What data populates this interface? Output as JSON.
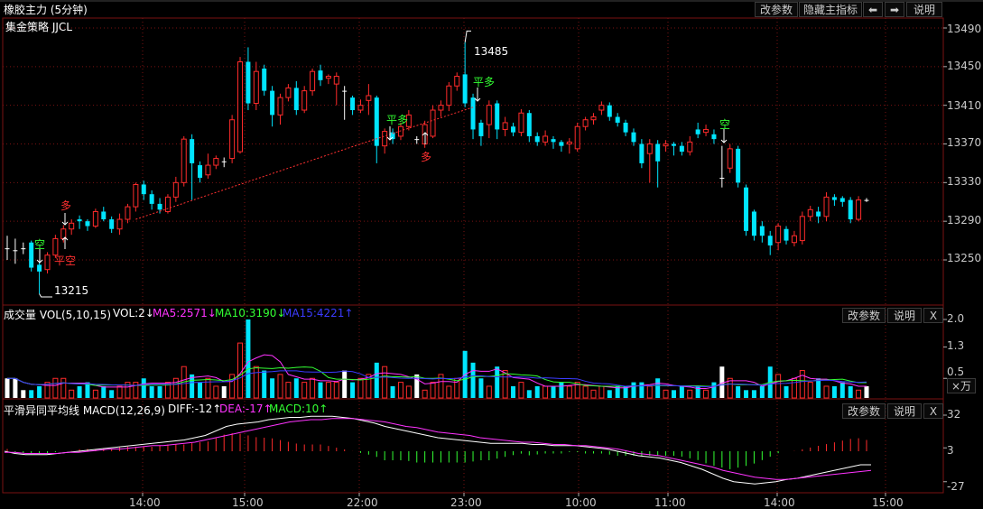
{
  "title": "橡胶主力 (5分钟)",
  "strategy_label": "集金策略 JJCL",
  "buttons": {
    "params": "改参数",
    "hide_main": "隐藏主指标",
    "help": "说明",
    "close": "X",
    "unit": "×万"
  },
  "icons": [
    "arrow-left-icon",
    "arrow-right-icon"
  ],
  "colors": {
    "up": "#ff2b2b",
    "down": "#00e5ff",
    "flat": "#ffffff",
    "grid": "#7a1212",
    "ma5": "#ff33ff",
    "ma10": "#33ff33",
    "ma15": "#3b3bff",
    "dif": "#ffffff",
    "dea": "#ff33ff"
  },
  "price_axis": {
    "ticks": [
      "13490",
      "13450",
      "13410",
      "13370",
      "13330",
      "13290",
      "13250"
    ]
  },
  "vol_axis": {
    "ticks": [
      "2.0",
      "1.3",
      "0.5"
    ]
  },
  "macd_axis": {
    "ticks": [
      "32",
      "3",
      "-27"
    ]
  },
  "time_axis": {
    "labels": [
      "14:00",
      "15:00",
      "22:00",
      "23:00",
      "10:00",
      "11:00",
      "14:00",
      "15:00"
    ]
  },
  "volume_panel": {
    "name": "成交量 VOL(5,10,15)",
    "vol": "VOL:2↓",
    "ma5": "MA5:2571↓",
    "ma10": "MA10:3190↓",
    "ma15": "MA15:4221↑"
  },
  "macd_panel": {
    "name": "平滑异同平均线 MACD(12,26,9)",
    "diff": "DIFF:-12↑",
    "dea": "DEA:-17↑",
    "macd": "MACD:10↑"
  },
  "annotations": {
    "high": "13485",
    "low": "13215",
    "long": "多",
    "short": "空",
    "close_long": "平多",
    "close_short": "平空"
  },
  "chart_data": {
    "type": "candlestick",
    "title": "橡胶主力 (5分钟)",
    "price_range": [
      13215,
      13490
    ],
    "candles": [
      {
        "open": 13262,
        "close": 13262,
        "high": 13275,
        "low": 13250
      },
      {
        "open": 13260,
        "close": 13260,
        "high": 13272,
        "low": 13246
      },
      {
        "open": 13262,
        "close": 13262,
        "high": 13268,
        "low": 13256
      },
      {
        "open": 13268,
        "close": 13242,
        "high": 13270,
        "low": 13238
      },
      {
        "open": 13245,
        "close": 13238,
        "high": 13248,
        "low": 13215
      },
      {
        "open": 13240,
        "close": 13255,
        "high": 13258,
        "low": 13236
      },
      {
        "open": 13255,
        "close": 13272,
        "high": 13276,
        "low": 13252
      },
      {
        "open": 13272,
        "close": 13282,
        "high": 13286,
        "low": 13268
      },
      {
        "open": 13282,
        "close": 13288,
        "high": 13292,
        "low": 13276
      },
      {
        "open": 13292,
        "close": 13290,
        "high": 13296,
        "low": 13282
      },
      {
        "open": 13290,
        "close": 13285,
        "high": 13292,
        "low": 13280
      },
      {
        "open": 13285,
        "close": 13300,
        "high": 13303,
        "low": 13283
      },
      {
        "open": 13300,
        "close": 13292,
        "high": 13305,
        "low": 13290
      },
      {
        "open": 13292,
        "close": 13282,
        "high": 13295,
        "low": 13278
      },
      {
        "open": 13282,
        "close": 13292,
        "high": 13298,
        "low": 13276
      },
      {
        "open": 13292,
        "close": 13305,
        "high": 13308,
        "low": 13288
      },
      {
        "open": 13305,
        "close": 13328,
        "high": 13330,
        "low": 13300
      },
      {
        "open": 13328,
        "close": 13318,
        "high": 13332,
        "low": 13312
      },
      {
        "open": 13318,
        "close": 13308,
        "high": 13322,
        "low": 13302
      },
      {
        "open": 13308,
        "close": 13302,
        "high": 13314,
        "low": 13298
      },
      {
        "open": 13300,
        "close": 13315,
        "high": 13318,
        "low": 13298
      },
      {
        "open": 13315,
        "close": 13330,
        "high": 13336,
        "low": 13310
      },
      {
        "open": 13330,
        "close": 13375,
        "high": 13378,
        "low": 13326
      },
      {
        "open": 13375,
        "close": 13350,
        "high": 13380,
        "low": 13312
      },
      {
        "open": 13348,
        "close": 13335,
        "high": 13352,
        "low": 13330
      },
      {
        "open": 13338,
        "close": 13348,
        "high": 13360,
        "low": 13334
      },
      {
        "open": 13348,
        "close": 13355,
        "high": 13358,
        "low": 13344
      },
      {
        "open": 13352,
        "close": 13352,
        "high": 13356,
        "low": 13346
      },
      {
        "open": 13355,
        "close": 13395,
        "high": 13400,
        "low": 13350
      },
      {
        "open": 13362,
        "close": 13455,
        "high": 13460,
        "low": 13360
      },
      {
        "open": 13455,
        "close": 13412,
        "high": 13470,
        "low": 13405
      },
      {
        "open": 13412,
        "close": 13445,
        "high": 13455,
        "low": 13405
      },
      {
        "open": 13448,
        "close": 13425,
        "high": 13452,
        "low": 13420
      },
      {
        "open": 13425,
        "close": 13400,
        "high": 13430,
        "low": 13388
      },
      {
        "open": 13400,
        "close": 13418,
        "high": 13422,
        "low": 13390
      },
      {
        "open": 13418,
        "close": 13428,
        "high": 13432,
        "low": 13414
      },
      {
        "open": 13428,
        "close": 13405,
        "high": 13435,
        "low": 13400
      },
      {
        "open": 13405,
        "close": 13425,
        "high": 13430,
        "low": 13402
      },
      {
        "open": 13425,
        "close": 13445,
        "high": 13448,
        "low": 13420
      },
      {
        "open": 13446,
        "close": 13436,
        "high": 13452,
        "low": 13430
      },
      {
        "open": 13438,
        "close": 13440,
        "high": 13442,
        "low": 13432
      },
      {
        "open": 13432,
        "close": 13440,
        "high": 13444,
        "low": 13410
      },
      {
        "open": 13425,
        "close": 13425,
        "high": 13430,
        "low": 13395
      },
      {
        "open": 13418,
        "close": 13405,
        "high": 13420,
        "low": 13400
      },
      {
        "open": 13405,
        "close": 13410,
        "high": 13416,
        "low": 13402
      },
      {
        "open": 13415,
        "close": 13420,
        "high": 13432,
        "low": 13400
      },
      {
        "open": 13418,
        "close": 13368,
        "high": 13420,
        "low": 13350
      },
      {
        "open": 13368,
        "close": 13383,
        "high": 13386,
        "low": 13360
      },
      {
        "open": 13382,
        "close": 13375,
        "high": 13386,
        "low": 13370
      },
      {
        "open": 13378,
        "close": 13388,
        "high": 13392,
        "low": 13374
      },
      {
        "open": 13388,
        "close": 13400,
        "high": 13405,
        "low": 13384
      },
      {
        "open": 13375,
        "close": 13375,
        "high": 13378,
        "low": 13370
      },
      {
        "open": 13370,
        "close": 13390,
        "high": 13394,
        "low": 13366
      },
      {
        "open": 13378,
        "close": 13405,
        "high": 13410,
        "low": 13376
      },
      {
        "open": 13405,
        "close": 13410,
        "high": 13415,
        "low": 13398
      },
      {
        "open": 13410,
        "close": 13430,
        "high": 13434,
        "low": 13404
      },
      {
        "open": 13430,
        "close": 13440,
        "high": 13444,
        "low": 13425
      },
      {
        "open": 13442,
        "close": 13412,
        "high": 13475,
        "low": 13408
      },
      {
        "open": 13418,
        "close": 13385,
        "high": 13422,
        "low": 13375
      },
      {
        "open": 13392,
        "close": 13378,
        "high": 13395,
        "low": 13368
      },
      {
        "open": 13390,
        "close": 13410,
        "high": 13415,
        "low": 13376
      },
      {
        "open": 13412,
        "close": 13385,
        "high": 13415,
        "low": 13375
      },
      {
        "open": 13385,
        "close": 13392,
        "high": 13398,
        "low": 13378
      },
      {
        "open": 13388,
        "close": 13382,
        "high": 13392,
        "low": 13378
      },
      {
        "open": 13382,
        "close": 13402,
        "high": 13406,
        "low": 13378
      },
      {
        "open": 13402,
        "close": 13378,
        "high": 13405,
        "low": 13372
      },
      {
        "open": 13378,
        "close": 13372,
        "high": 13382,
        "low": 13368
      },
      {
        "open": 13372,
        "close": 13378,
        "high": 13384,
        "low": 13368
      },
      {
        "open": 13375,
        "close": 13372,
        "high": 13378,
        "low": 13365
      },
      {
        "open": 13372,
        "close": 13368,
        "high": 13374,
        "low": 13362
      },
      {
        "open": 13370,
        "close": 13372,
        "high": 13376,
        "low": 13360
      },
      {
        "open": 13365,
        "close": 13388,
        "high": 13392,
        "low": 13362
      },
      {
        "open": 13388,
        "close": 13395,
        "high": 13398,
        "low": 13384
      },
      {
        "open": 13395,
        "close": 13398,
        "high": 13402,
        "low": 13390
      },
      {
        "open": 13405,
        "close": 13410,
        "high": 13414,
        "low": 13400
      },
      {
        "open": 13410,
        "close": 13398,
        "high": 13413,
        "low": 13394
      },
      {
        "open": 13398,
        "close": 13392,
        "high": 13402,
        "low": 13388
      },
      {
        "open": 13392,
        "close": 13382,
        "high": 13395,
        "low": 13378
      },
      {
        "open": 13382,
        "close": 13372,
        "high": 13386,
        "low": 13368
      },
      {
        "open": 13370,
        "close": 13350,
        "high": 13375,
        "low": 13345
      },
      {
        "open": 13360,
        "close": 13370,
        "high": 13375,
        "low": 13330
      },
      {
        "open": 13370,
        "close": 13352,
        "high": 13374,
        "low": 13325
      },
      {
        "open": 13368,
        "close": 13370,
        "high": 13374,
        "low": 13362
      },
      {
        "open": 13370,
        "close": 13368,
        "high": 13372,
        "low": 13358
      },
      {
        "open": 13368,
        "close": 13362,
        "high": 13372,
        "low": 13358
      },
      {
        "open": 13362,
        "close": 13372,
        "high": 13378,
        "low": 13358
      },
      {
        "open": 13385,
        "close": 13380,
        "high": 13392,
        "low": 13376
      },
      {
        "open": 13382,
        "close": 13385,
        "high": 13390,
        "low": 13378
      },
      {
        "open": 13380,
        "close": 13375,
        "high": 13385,
        "low": 13370
      },
      {
        "open": 13335,
        "close": 13335,
        "high": 13368,
        "low": 13325
      },
      {
        "open": 13345,
        "close": 13365,
        "high": 13370,
        "low": 13340
      },
      {
        "open": 13365,
        "close": 13330,
        "high": 13368,
        "low": 13325
      },
      {
        "open": 13325,
        "close": 13280,
        "high": 13328,
        "low": 13275
      },
      {
        "open": 13300,
        "close": 13275,
        "high": 13302,
        "low": 13270
      },
      {
        "open": 13285,
        "close": 13275,
        "high": 13290,
        "low": 13268
      },
      {
        "open": 13275,
        "close": 13265,
        "high": 13280,
        "low": 13255
      },
      {
        "open": 13268,
        "close": 13285,
        "high": 13288,
        "low": 13260
      },
      {
        "open": 13282,
        "close": 13270,
        "high": 13285,
        "low": 13266
      },
      {
        "open": 13268,
        "close": 13275,
        "high": 13280,
        "low": 13264
      },
      {
        "open": 13270,
        "close": 13295,
        "high": 13300,
        "low": 13266
      },
      {
        "open": 13295,
        "close": 13302,
        "high": 13306,
        "low": 13290
      },
      {
        "open": 13300,
        "close": 13295,
        "high": 13305,
        "low": 13288
      },
      {
        "open": 13295,
        "close": 13315,
        "high": 13320,
        "low": 13290
      },
      {
        "open": 13315,
        "close": 13312,
        "high": 13318,
        "low": 13306
      },
      {
        "open": 13314,
        "close": 13310,
        "high": 13316,
        "low": 13305
      },
      {
        "open": 13312,
        "close": 13292,
        "high": 13315,
        "low": 13288
      },
      {
        "open": 13292,
        "close": 13312,
        "high": 13316,
        "low": 13290
      },
      {
        "open": 13312,
        "close": 13312,
        "high": 13314,
        "low": 13310
      }
    ],
    "volume": [
      0.5,
      0.5,
      0.2,
      0.2,
      0.3,
      0.4,
      0.5,
      0.5,
      0.2,
      0.3,
      0.4,
      0.2,
      0.3,
      0.2,
      0.3,
      0.4,
      0.4,
      0.5,
      0.3,
      0.3,
      0.4,
      0.5,
      0.8,
      0.6,
      0.4,
      0.5,
      0.3,
      0.3,
      0.6,
      1.4,
      2.0,
      0.8,
      0.7,
      0.5,
      0.6,
      0.4,
      0.5,
      0.4,
      0.5,
      0.4,
      0.4,
      0.4,
      0.7,
      0.4,
      0.5,
      0.6,
      0.9,
      0.8,
      0.3,
      0.4,
      0.3,
      0.6,
      0.2,
      0.4,
      0.6,
      0.3,
      0.5,
      1.2,
      0.9,
      0.5,
      0.3,
      0.8,
      0.7,
      0.3,
      0.4,
      0.2,
      0.3,
      0.3,
      0.3,
      0.4,
      0.3,
      0.4,
      0.3,
      0.2,
      0.3,
      0.2,
      0.3,
      0.3,
      0.4,
      0.4,
      0.3,
      0.5,
      0.2,
      0.2,
      0.3,
      0.2,
      0.3,
      0.2,
      0.4,
      0.8,
      0.5,
      0.3,
      0.2,
      0.2,
      0.3,
      0.8,
      0.6,
      0.3,
      0.5,
      0.7,
      0.4,
      0.5,
      0.3,
      0.3,
      0.4,
      0.3,
      0.2,
      0.3,
      0.4,
      0.3,
      0.4,
      0.2,
      0.3,
      0.2
    ],
    "dif": [
      0,
      -2,
      -3,
      -3,
      -3,
      -2,
      -1,
      0,
      1,
      2,
      3,
      4,
      5,
      6,
      7,
      8,
      9,
      10,
      12,
      14,
      18,
      22,
      24,
      25,
      26,
      28,
      29,
      30,
      30,
      31,
      31,
      31,
      30,
      29,
      27,
      25,
      22,
      20,
      18,
      16,
      14,
      12,
      11,
      10,
      9,
      8,
      7,
      7,
      7,
      7,
      6,
      6,
      5,
      5,
      5,
      4,
      3,
      2,
      0,
      -2,
      -4,
      -5,
      -6,
      -8,
      -10,
      -13,
      -16,
      -20,
      -24,
      -27,
      -28,
      -29,
      -28,
      -27,
      -25,
      -24,
      -22,
      -20,
      -18,
      -16,
      -14,
      -12,
      -12
    ],
    "dea": [
      -1,
      -1,
      -2,
      -2,
      -2,
      -2,
      -1,
      -1,
      0,
      1,
      2,
      2,
      3,
      4,
      5,
      5,
      6,
      7,
      8,
      10,
      12,
      14,
      16,
      18,
      20,
      22,
      24,
      26,
      27,
      28,
      28,
      29,
      29,
      29,
      28,
      27,
      26,
      24,
      22,
      21,
      19,
      17,
      16,
      15,
      14,
      12,
      11,
      10,
      9,
      8,
      8,
      7,
      6,
      6,
      5,
      5,
      4,
      3,
      2,
      0,
      -2,
      -3,
      -4,
      -6,
      -8,
      -10,
      -12,
      -14,
      -17,
      -19,
      -21,
      -23,
      -24,
      -25,
      -25,
      -24,
      -23,
      -22,
      -21,
      -20,
      -19,
      -18,
      -17
    ]
  }
}
